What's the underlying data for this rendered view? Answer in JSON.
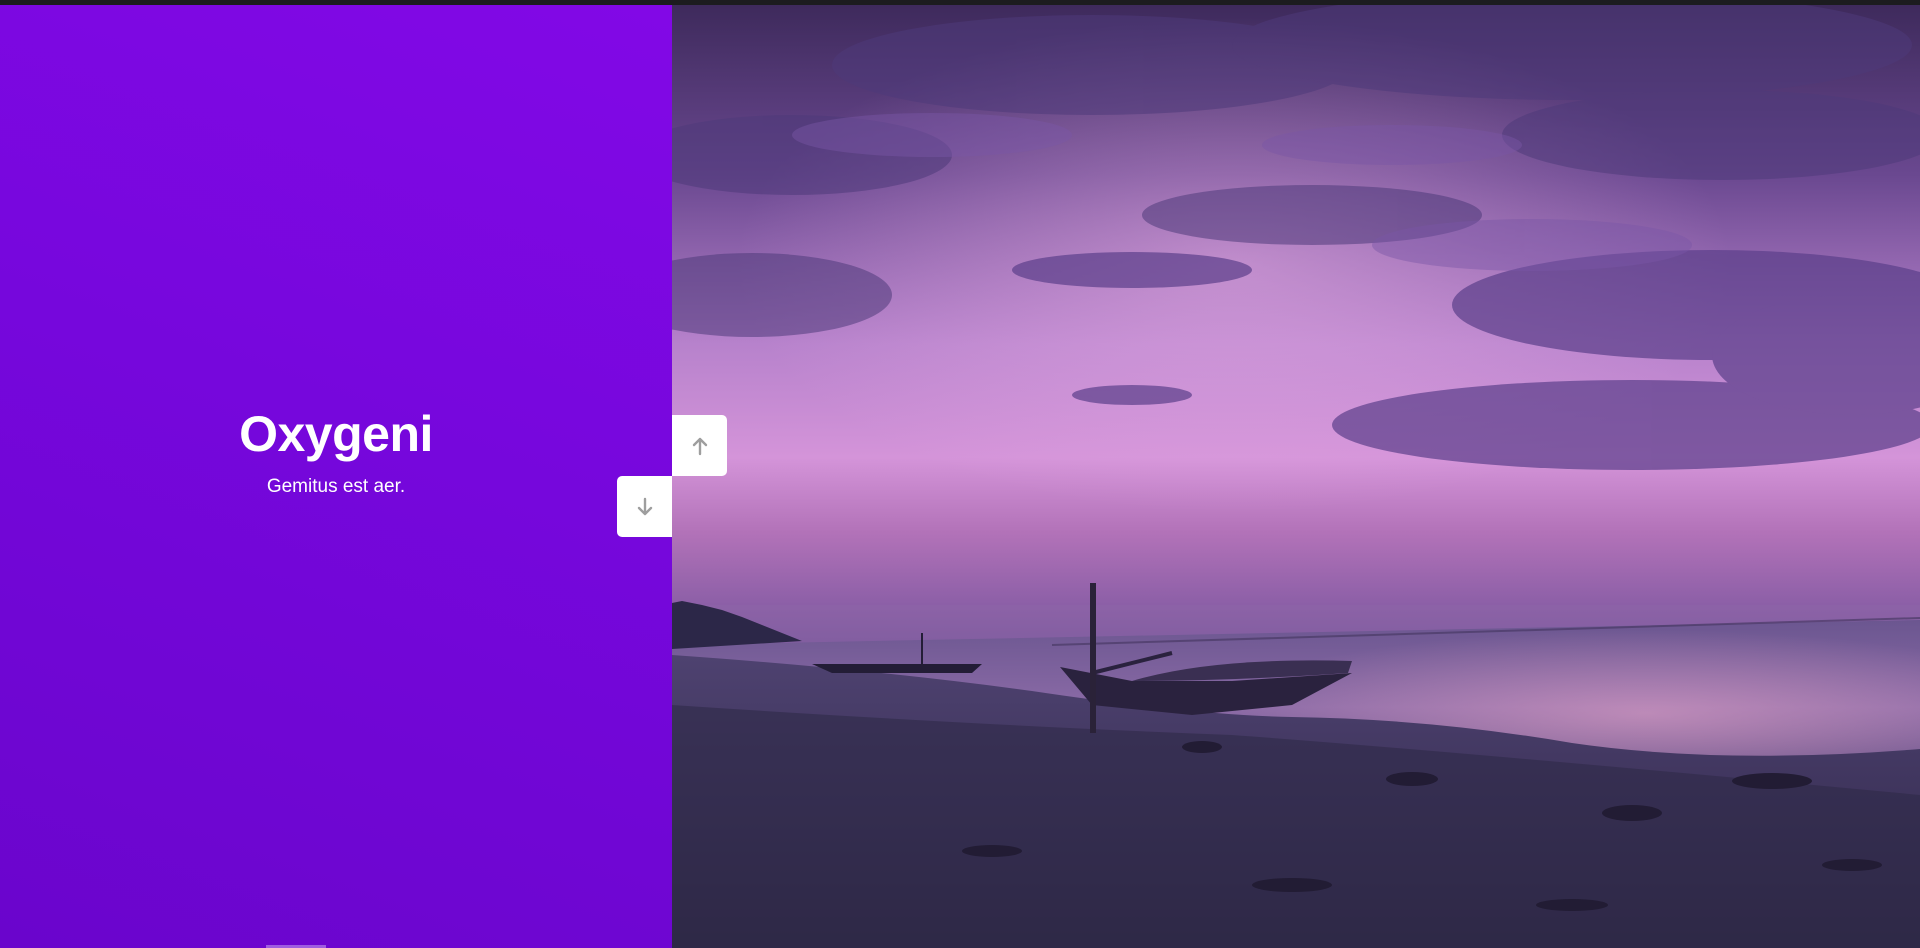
{
  "slide": {
    "title": "Oxygeni",
    "subtitle": "Gemitus est aer."
  },
  "navigation": {
    "up_icon": "arrow-up-icon",
    "down_icon": "arrow-down-icon"
  },
  "colors": {
    "panel_accent": "#7607dc",
    "button_background": "#ffffff",
    "arrow_icon": "#9e9e9e"
  }
}
